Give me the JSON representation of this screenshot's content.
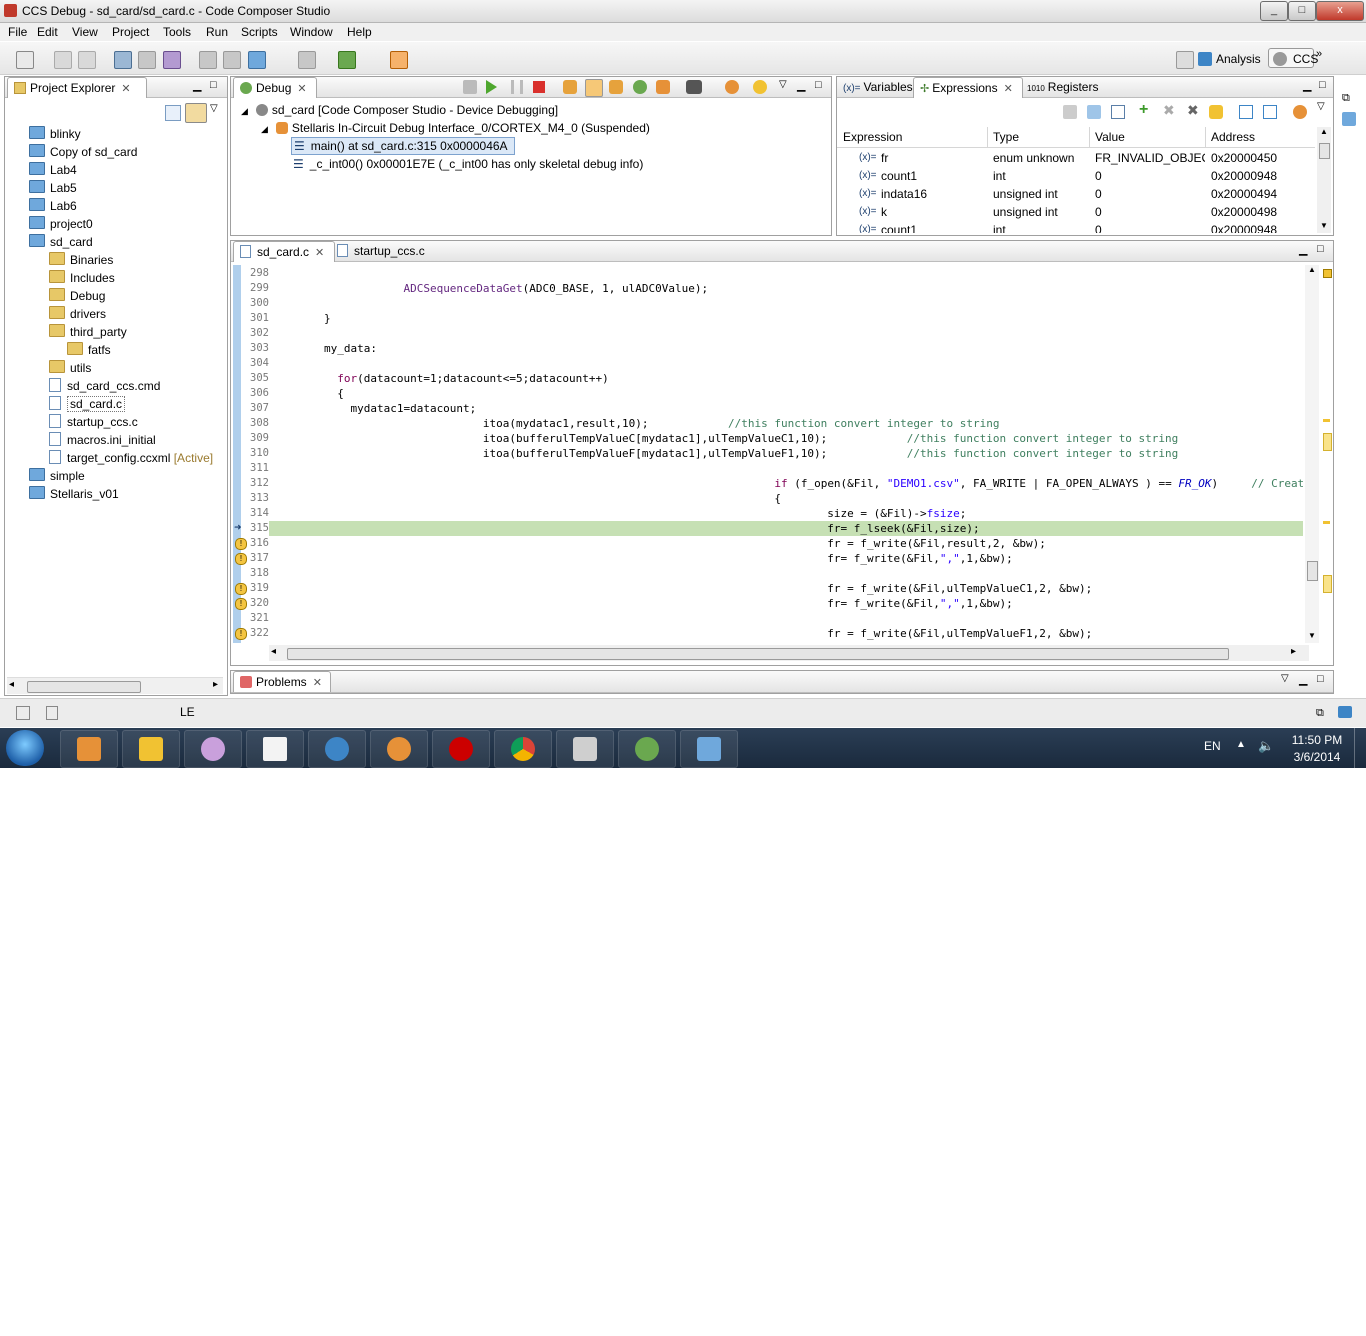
{
  "window": {
    "title": "CCS Debug - sd_card/sd_card.c - Code Composer Studio",
    "min": "_",
    "max": "□",
    "close": "x"
  },
  "menu": [
    "File",
    "Edit",
    "View",
    "Project",
    "Tools",
    "Run",
    "Scripts",
    "Window",
    "Help"
  ],
  "perspectives": {
    "analysis": "Analysis",
    "ccs": "CCS",
    "more": "»"
  },
  "explorer": {
    "tab": "Project Explorer",
    "items": [
      {
        "label": "blinky",
        "type": "project"
      },
      {
        "label": "Copy of sd_card",
        "type": "project"
      },
      {
        "label": "Lab4",
        "type": "project"
      },
      {
        "label": "Lab5",
        "type": "project"
      },
      {
        "label": "Lab6",
        "type": "project"
      },
      {
        "label": "project0",
        "type": "project"
      },
      {
        "label": "sd_card",
        "type": "project"
      },
      {
        "label": "Binaries",
        "type": "child"
      },
      {
        "label": "Includes",
        "type": "child"
      },
      {
        "label": "Debug",
        "type": "child"
      },
      {
        "label": "drivers",
        "type": "child"
      },
      {
        "label": "third_party",
        "type": "child"
      },
      {
        "label": "fatfs",
        "type": "grandchild"
      },
      {
        "label": "utils",
        "type": "child"
      },
      {
        "label": "sd_card_ccs.cmd",
        "type": "childfile"
      },
      {
        "label": "sd_card.c",
        "type": "childfile"
      },
      {
        "label": "startup_ccs.c",
        "type": "childfile"
      },
      {
        "label": "macros.ini_initial",
        "type": "childfile"
      },
      {
        "label": "target_config.ccxml",
        "type": "childfile",
        "tag": "[Active]"
      },
      {
        "label": "simple",
        "type": "project"
      },
      {
        "label": "Stellaris_v01",
        "type": "project"
      }
    ]
  },
  "debug": {
    "tab": "Debug",
    "root": "sd_card [Code Composer Studio - Device Debugging]",
    "target": "Stellaris In-Circuit Debug Interface_0/CORTEX_M4_0 (Suspended)",
    "frames": [
      "main() at sd_card.c:315 0x0000046A",
      "_c_int00() 0x00001E7E  (_c_int00 has only skeletal debug info)"
    ]
  },
  "vars": {
    "tabs": [
      "Variables",
      "Expressions",
      "Registers"
    ],
    "columns": [
      "Expression",
      "Type",
      "Value",
      "Address"
    ],
    "rows": [
      {
        "name": "fr",
        "type": "enum unknown",
        "value": "FR_INVALID_OBJECT",
        "addr": "0x20000450"
      },
      {
        "name": "count1",
        "type": "int",
        "value": "0",
        "addr": "0x20000948"
      },
      {
        "name": "indata16",
        "type": "unsigned int",
        "value": "0",
        "addr": "0x20000494"
      },
      {
        "name": "k",
        "type": "unsigned int",
        "value": "0",
        "addr": "0x20000498"
      },
      {
        "name": "count1",
        "type": "int",
        "value": "0",
        "addr": "0x20000948"
      }
    ],
    "row_prefix": "(x)="
  },
  "editor": {
    "tabs": [
      "sd_card.c",
      "startup_ccs.c"
    ],
    "lines": [
      {
        "n": "298",
        "t": ""
      },
      {
        "n": "299",
        "t": "                    ADCSequenceDataGet(ADC0_BASE, 1, ulADC0Value);"
      },
      {
        "n": "300",
        "t": ""
      },
      {
        "n": "301",
        "t": "        }"
      },
      {
        "n": "302",
        "t": ""
      },
      {
        "n": "303",
        "t": "        my_data:"
      },
      {
        "n": "304",
        "t": ""
      },
      {
        "n": "305",
        "t": "          for(datacount=1;datacount<=5;datacount++)"
      },
      {
        "n": "306",
        "t": "          {"
      },
      {
        "n": "307",
        "t": "            mydatac1=datacount;"
      },
      {
        "n": "308",
        "t": "                                itoa(mydatac1,result,10);            //this function convert integer to string"
      },
      {
        "n": "309",
        "t": "                                itoa(bufferulTempValueC[mydatac1],ulTempValueC1,10);            //this function convert integer to string"
      },
      {
        "n": "310",
        "t": "                                itoa(bufferulTempValueF[mydatac1],ulTempValueF1,10);            //this function convert integer to string"
      },
      {
        "n": "311",
        "t": ""
      },
      {
        "n": "312",
        "t": "                                                                            if (f_open(&Fil, \"DEMO1.csv\", FA_WRITE | FA_OPEN_ALWAYS ) == FR_OK)     // Creat"
      },
      {
        "n": "313",
        "t": "                                                                            {"
      },
      {
        "n": "314",
        "t": "                                                                                    size = (&Fil)->fsize;"
      },
      {
        "n": "315",
        "t": "                                                                                    fr= f_lseek(&Fil,size);"
      },
      {
        "n": "316",
        "t": "                                                                                    fr = f_write(&Fil,result,2, &bw);"
      },
      {
        "n": "317",
        "t": "                                                                                    fr= f_write(&Fil,\",\",1,&bw);"
      },
      {
        "n": "318",
        "t": ""
      },
      {
        "n": "319",
        "t": "                                                                                    fr = f_write(&Fil,ulTempValueC1,2, &bw);"
      },
      {
        "n": "320",
        "t": "                                                                                    fr= f_write(&Fil,\",\",1,&bw);"
      },
      {
        "n": "321",
        "t": ""
      },
      {
        "n": "322",
        "t": "                                                                                    fr = f_write(&Fil,ulTempValueF1,2, &bw);"
      }
    ],
    "current_line": "315",
    "warning_lines": [
      "316",
      "317",
      "319",
      "320",
      "322"
    ]
  },
  "problems": {
    "tab": "Problems"
  },
  "status": {
    "mode": "LE"
  },
  "taskbar": {
    "lang": "EN",
    "time": "11:50 PM",
    "date": "3/6/2014"
  }
}
